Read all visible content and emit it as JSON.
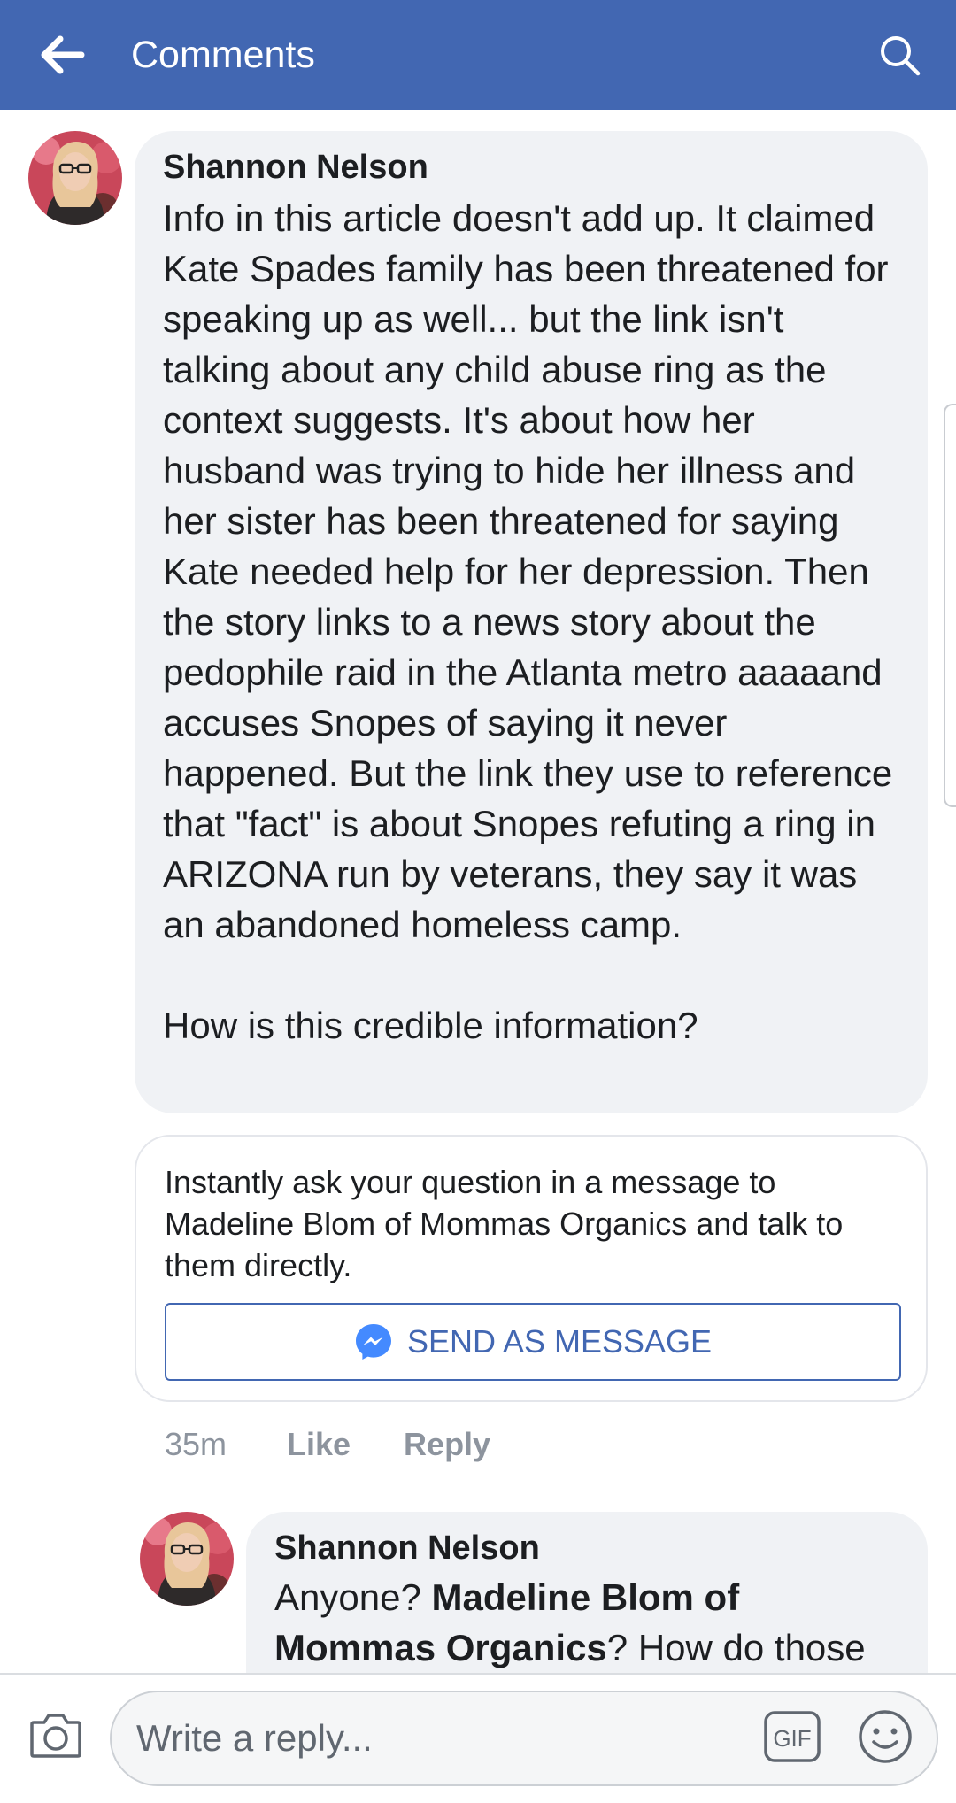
{
  "header": {
    "title": "Comments",
    "back_icon": "back-arrow-icon",
    "search_icon": "search-icon"
  },
  "comment": {
    "author": "Shannon Nelson",
    "text": "Info in this article doesn't add up.  It claimed Kate Spades family has been threatened for speaking up as well... but the link isn't talking about any child abuse ring as the context suggests. It's about how her husband was trying to hide her illness and her sister has been threatened for saying Kate needed help for her depression. Then the story links to a news story about the pedophile raid in the Atlanta metro aaaaand accuses Snopes of saying it never happened. But the link they use to reference that \"fact\" is about Snopes refuting a ring in ARIZONA run by veterans, they say it was an abandoned homeless camp.\n\nHow is this credible information?",
    "time": "35m",
    "like_label": "Like",
    "reply_label": "Reply"
  },
  "message_prompt": {
    "text": "Instantly ask your question in a message to Madeline Blom of Mommas Organics and talk to them directly.",
    "button_label": "SEND AS MESSAGE",
    "button_icon": "messenger-icon"
  },
  "reply": {
    "author": "Shannon Nelson",
    "text_before": "Anyone? ",
    "mention": "Madeline Blom of Mommas Organics",
    "text_after": "? How do those"
  },
  "composer": {
    "placeholder": "Write a reply...",
    "camera_icon": "camera-icon",
    "gif_label": "GIF",
    "emoji_icon": "emoji-icon"
  },
  "colors": {
    "brand": "#4267b2",
    "bubble": "#f0f2f5",
    "muted": "#8d949e"
  }
}
